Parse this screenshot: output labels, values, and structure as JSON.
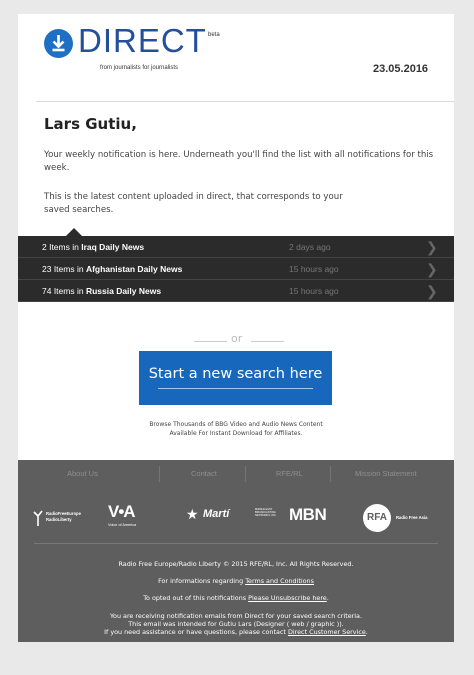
{
  "header": {
    "brand": "DIRECT",
    "beta": "beta",
    "tagline": "from journalists for journalists",
    "date": "23.05.2016"
  },
  "greeting": "Lars Gutiu,",
  "intro": "Your weekly notification is here. Underneath you'll find the list with all notifications for this week.",
  "intro2": "This is the latest content uploaded in direct, that corresponds to your saved searches.",
  "rows": [
    {
      "count": "2 Items in",
      "name": "Iraq Daily News",
      "time": "2 days ago"
    },
    {
      "count": "23 Items in",
      "name": "Afghanistan Daily News",
      "time": "15 hours ago"
    },
    {
      "count": "74 Items in",
      "name": "Russia Daily News",
      "time": "15 hours ago"
    }
  ],
  "or": "or",
  "cta": "Start a new search here",
  "note1": "Browse Thousands of BBG Video and Audio News Content",
  "note2": "Available For Instant Download for Affiliates.",
  "footer": {
    "nav": [
      "About Us",
      "Contact",
      "RFE/RL",
      "Mission Statement"
    ],
    "logos": {
      "rferl1": "RadioFreeEurope",
      "rferl2": "RadioLiberty",
      "voa": "V•A",
      "voa_sub": "Voice of America",
      "marti": "Martí",
      "mbn_small": "MIDDLE EAST BROADCASTING NETWORKS, INC.",
      "mbn": "MBN",
      "rfa": "RFA",
      "rfa_text": "Radio Free Asia"
    },
    "copyright": "Radio Free Europe/Radio Liberty © 2015 RFE/RL, Inc. All Rights Reserved.",
    "info_prefix": "For informations regarding ",
    "info_link": "Terms and Conditions",
    "optout_prefix": "To opted out of this notifications ",
    "optout_link": "Please Unsubscribe here",
    "optout_suffix": ".",
    "receiving": "You are receiving notification emails from Direct for your saved search criteria.",
    "intended": "This email was intended for Gutiu Lars (Designer ( web / graphic )).",
    "assist_prefix": "If you need assistance or have questions, please contact ",
    "assist_link": "Direct Customer Service",
    "assist_suffix": "."
  },
  "colors": {
    "brand_blue": "#1767bd",
    "dark_row": "#2b2b2b",
    "footer": "#5e5e5e"
  },
  "icons": {
    "logo": "download-arrow-icon",
    "row": "chevron-right-icon"
  }
}
